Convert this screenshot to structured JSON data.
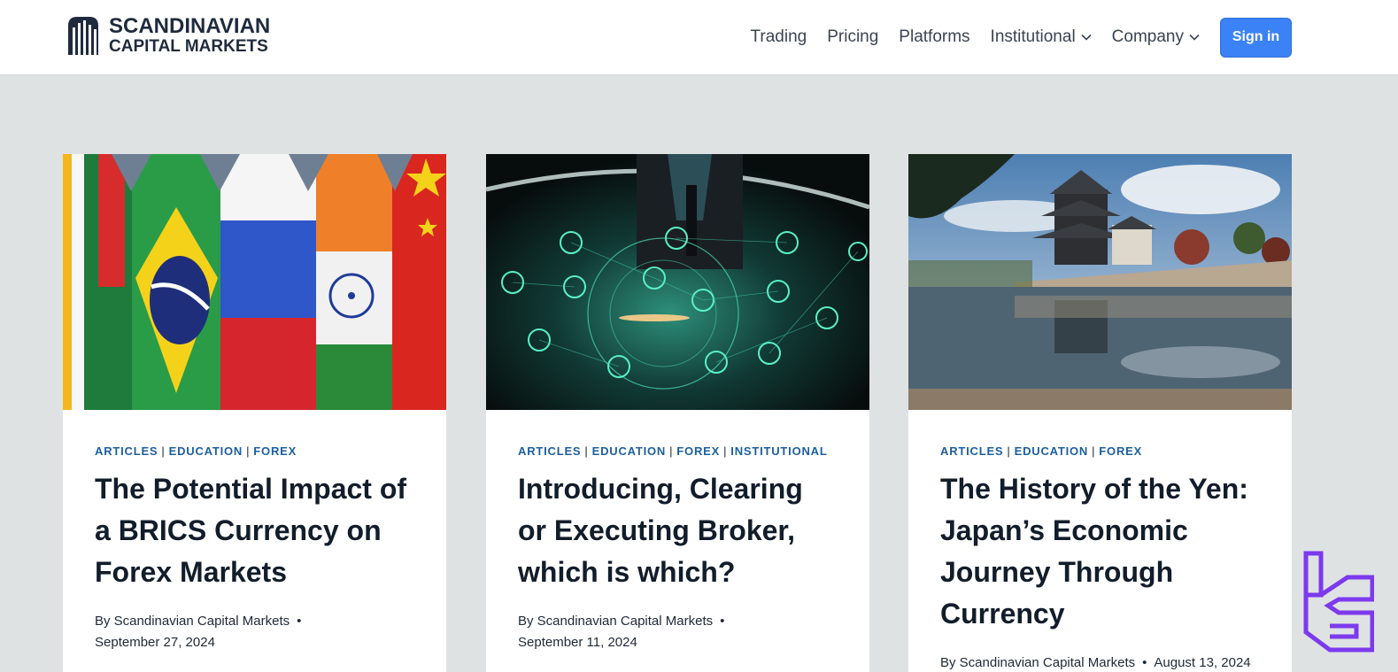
{
  "brand": {
    "line1": "SCANDINAVIAN",
    "line2": "CAPITAL MARKETS"
  },
  "nav": {
    "items": [
      {
        "label": "Trading",
        "dropdown": false
      },
      {
        "label": "Pricing",
        "dropdown": false
      },
      {
        "label": "Platforms",
        "dropdown": false
      },
      {
        "label": "Institutional",
        "dropdown": true
      },
      {
        "label": "Company",
        "dropdown": true
      }
    ],
    "signin_label": "Sign in"
  },
  "colors": {
    "accent": "#3b82f6",
    "category": "#1d5f9e",
    "page_bg": "#dfe2e3",
    "watermark": "#7c3aed"
  },
  "posts": [
    {
      "image": "brics-flags-photo",
      "categories": [
        "ARTICLES",
        "EDUCATION",
        "FOREX"
      ],
      "title": "The Potential Impact of a BRICS Currency on Forex Markets",
      "author": "By Scandinavian Capital Markets",
      "date": "September 27, 2024"
    },
    {
      "image": "businessman-network-globe-photo",
      "categories": [
        "ARTICLES",
        "EDUCATION",
        "FOREX",
        "INSTITUTIONAL"
      ],
      "title": "Introducing, Clearing or Executing Broker, which is which?",
      "author": "By Scandinavian Capital Markets",
      "date": "September 11, 2024"
    },
    {
      "image": "japanese-castle-reflection-photo",
      "categories": [
        "ARTICLES",
        "EDUCATION",
        "FOREX"
      ],
      "title": "The History of the Yen: Japan’s Economic Journey Through Currency",
      "author": "By Scandinavian Capital Markets",
      "date": "August 13, 2024"
    }
  ]
}
